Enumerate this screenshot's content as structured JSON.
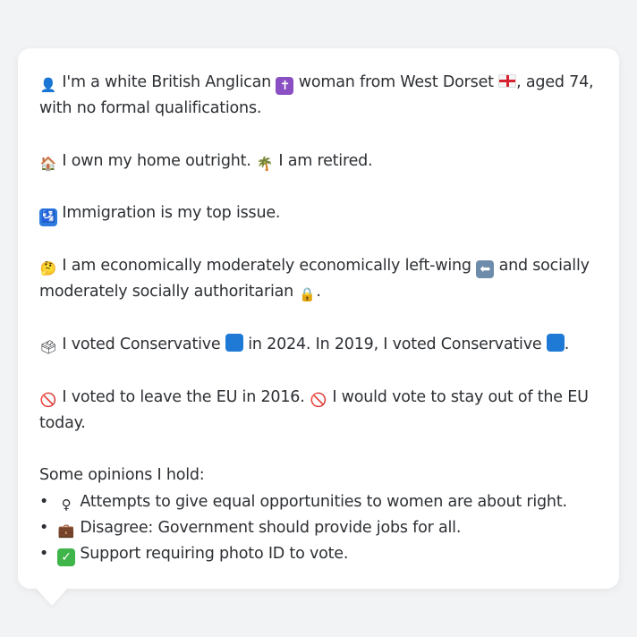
{
  "profile": {
    "line1_a": "I'm a white British Anglican",
    "line1_b": "woman from West Dorset",
    "line1_c": ", aged 74, with no formal qualifications.",
    "home_a": "I own my home outright.",
    "home_b": "I am retired.",
    "issue": "Immigration is my top issue.",
    "ideology_a": "I am economically moderately economically left-wing",
    "ideology_b": "and socially moderately socially authoritarian",
    "ideology_c": ".",
    "vote_a": "I voted Conservative",
    "vote_b": "in 2024. In 2019, I voted Conservative",
    "vote_c": ".",
    "eu_a": "I voted to leave the EU in 2016.",
    "eu_b": "I would vote to stay out of the EU today.",
    "opinions_header": "Some opinions I hold:",
    "opinions": [
      "Attempts to give equal opportunities to women are about right.",
      "Disagree: Government should provide jobs for all.",
      "Support requiring photo ID to vote."
    ],
    "bullet": "•"
  },
  "icons": {
    "person": "bust-in-silhouette-icon",
    "cross": "latin-cross-icon",
    "flag": "england-flag-icon",
    "house": "house-icon",
    "palm": "palm-tree-icon",
    "immigration": "passport-control-icon",
    "thinking": "thinking-face-icon",
    "left_arrow": "left-arrow-icon",
    "lock": "lock-icon",
    "ballot": "ballot-box-icon",
    "blue_square": "blue-square-icon",
    "prohibited": "prohibited-icon",
    "female": "female-sign-icon",
    "briefcase": "briefcase-icon",
    "check": "check-mark-button-icon"
  },
  "colors": {
    "conservative_blue": "#1f7ad6",
    "prohibited_red": "#e0302c",
    "check_green": "#3fb54a"
  }
}
